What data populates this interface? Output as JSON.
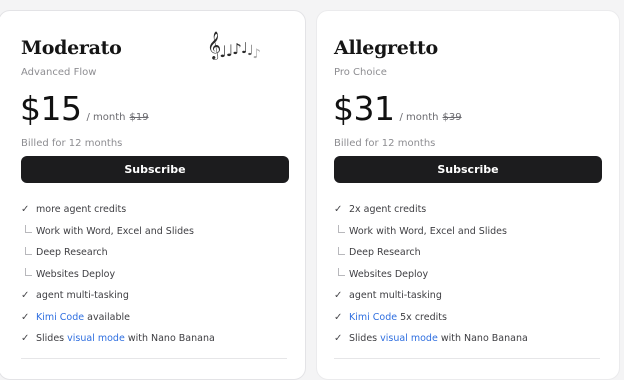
{
  "plans": [
    {
      "name": "Moderato",
      "subtitle": "Advanced Flow",
      "price": "$15",
      "per": "/ month",
      "old_price": "$19",
      "billed": "Billed for 12 months",
      "button": "Subscribe",
      "decoration_icon": "music-notes-icon",
      "features": [
        {
          "text": "more agent credits"
        },
        {
          "text": "Work with Word, Excel and Slides"
        },
        {
          "text": "Deep Research"
        },
        {
          "text": "Websites Deploy"
        },
        {
          "text": "agent multi-tasking"
        },
        {
          "link": "Kimi Code",
          "after": " available"
        },
        {
          "before": "Slides ",
          "link": "visual mode",
          "after": " with Nano Banana"
        }
      ]
    },
    {
      "name": "Allegretto",
      "subtitle": "Pro Choice",
      "price": "$31",
      "per": "/ month",
      "old_price": "$39",
      "billed": "Billed for 12 months",
      "button": "Subscribe",
      "features": [
        {
          "text": "2x agent credits"
        },
        {
          "text": "Work with Word, Excel and Slides"
        },
        {
          "text": "Deep Research"
        },
        {
          "text": "Websites Deploy"
        },
        {
          "text": "agent multi-tasking"
        },
        {
          "link": "Kimi Code",
          "after": " 5x credits"
        },
        {
          "before": "Slides ",
          "link": "visual mode",
          "after": " with Nano Banana"
        }
      ]
    }
  ],
  "colors": {
    "accent_link": "#2f6fe0",
    "button_bg": "#1c1c1e",
    "page_bg": "#f4f4f5"
  }
}
